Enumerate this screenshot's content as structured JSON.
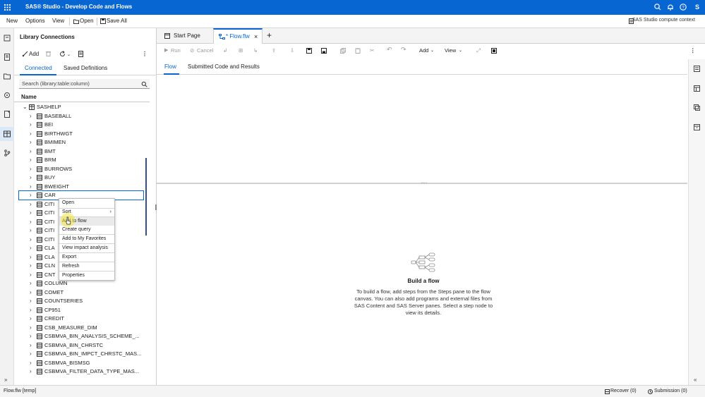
{
  "app": {
    "title": "SAS® Studio - Develop Code and Flows",
    "user_initial": "S",
    "accent_color": "#0766d1"
  },
  "menubar": {
    "items": [
      "New",
      "Options",
      "View"
    ],
    "open_label": "Open",
    "save_all_label": "Save All",
    "compute_context": "SAS Studio compute context"
  },
  "library_panel": {
    "title": "Library Connections",
    "add_label": "Add",
    "tabs": [
      "Connected",
      "Saved Definitions"
    ],
    "search_placeholder": "Search (library:table:column)",
    "column_header": "Name",
    "library": "SASHELP",
    "tables": [
      "BASEBALL",
      "BEI",
      "BIRTHWGT",
      "BMIMEN",
      "BMT",
      "BRM",
      "BURROWS",
      "BUY",
      "BWEIGHT",
      "CAR",
      "CITI",
      "CITI",
      "CITI",
      "CITI",
      "CITI",
      "CLA",
      "CLA",
      "CLN",
      "CNT",
      "COLUMN",
      "COMET",
      "COUNTSERIES",
      "CP951",
      "CREDIT",
      "CSB_MEASURE_DIM",
      "CSBMVA_BIN_ANALYSIS_SCHEME_...",
      "CSBMVA_BIN_CHRSTC",
      "CSBMVA_BIN_IMPCT_CHRSTC_MAS...",
      "CSBMVA_BISMSG",
      "CSBMVA_FILTER_DATA_TYPE_MAS..."
    ]
  },
  "context_menu": {
    "items": [
      "Open",
      "Sort",
      "Add to flow",
      "Create query",
      "Add to My Favorites",
      "View impact analysis",
      "Export",
      "Refresh",
      "Properties"
    ]
  },
  "doc_tabs": {
    "start_page": "Start Page",
    "flow_tab": "* Flow.flw"
  },
  "toolbar": {
    "run": "Run",
    "cancel": "Cancel",
    "add": "Add",
    "view": "View"
  },
  "sub_tabs": [
    "Flow",
    "Submitted Code and Results"
  ],
  "empty_state": {
    "title": "Build a flow",
    "description": "To build a flow, add steps from the Steps pane to the flow canvas. You can also add programs and external files from SAS Content and SAS Server panes. Select a step node to view its details."
  },
  "status": {
    "file": "Flow.flw [temp]",
    "recover": "Recover (0)",
    "submission": "Submission (0)"
  }
}
